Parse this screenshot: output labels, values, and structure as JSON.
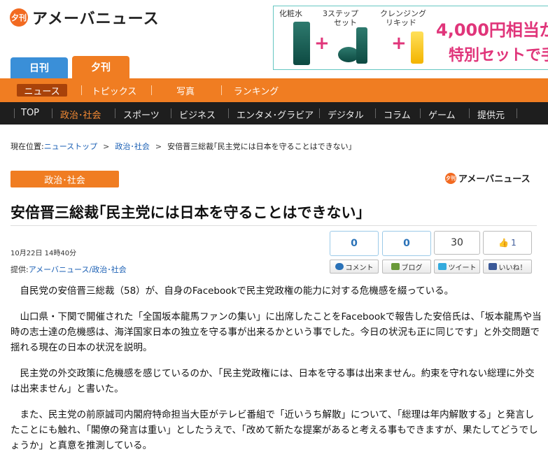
{
  "logo": {
    "badge": "夕刊",
    "text": "アメーバニュース"
  },
  "ad": {
    "labels": [
      "化粧水",
      "3ステップ",
      "セット",
      "クレンジング",
      "リキッド"
    ],
    "headline": "4,000円相当が",
    "sub": "特別セットで手"
  },
  "edition_tabs": [
    "日刊",
    "夕刊"
  ],
  "orange_nav": [
    "ニュース",
    "トピックス",
    "写真",
    "ランキング"
  ],
  "black_nav": [
    "TOP",
    "政治･社会",
    "スポーツ",
    "ビジネス",
    "エンタメ･グラビア",
    "デジタル",
    "コラム",
    "ゲーム",
    "提供元"
  ],
  "breadcrumb": {
    "prefix": "現在位置:",
    "items": [
      "ニューストップ",
      "政治･社会",
      "安倍晋三総裁｢民主党には日本を守ることはできない｣"
    ]
  },
  "category": "政治･社会",
  "small_logo": {
    "badge": "夕刊",
    "text": "アメーバニュース"
  },
  "headline": "安倍晋三総裁｢民主党には日本を守ることはできない｣",
  "date": "10月22日 14時40分",
  "source": {
    "prefix": "提供:",
    "name": "アメーバニュース/政治･社会"
  },
  "social": {
    "comment_count": "0",
    "blog_count": "0",
    "tweet_count": "30",
    "like_count": "1",
    "comment_label": "コメント",
    "blog_label": "ブログ",
    "tweet_label": "ツイート",
    "like_label": "いいね！",
    "colors": {
      "twitter": "#33aadd",
      "facebook": "#3b5998",
      "accent": "#f07d22"
    }
  },
  "article": [
    "自民党の安倍晋三総裁（58）が、自身のFacebookで民主党政権の能力に対する危機感を綴っている。",
    "山口県・下関で開催された「全国坂本龍馬ファンの集い」に出席したことをFacebookで報告した安倍氏は、「坂本龍馬や当時の志士達の危機感は、海洋国家日本の独立を守る事が出来るかという事でした。今日の状況も正に同じです」と外交問題で揺れる現在の日本の状況を説明。",
    "民主党の外交政策に危機感を感じているのか、「民主党政権には、日本を守る事は出来ません。約束を守れない総理に外交は出来ません」と書いた。",
    "また、民主党の前原誠司内閣府特命担当大臣がテレビ番組で「近いうち解散」について、「総理は年内解散する」と発言したことにも触れ、「閣僚の発言は重い」としたうえで、「改めて新たな提案があると考える事もできますが、果たしてどうでしょうか」と真意を推測している。"
  ]
}
